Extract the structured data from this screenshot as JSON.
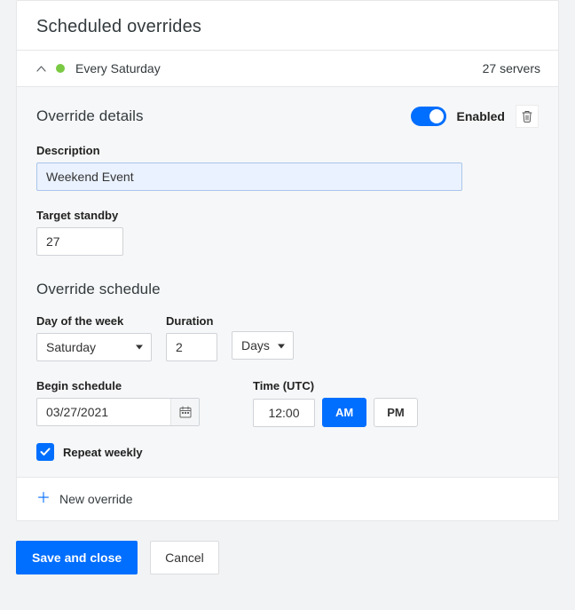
{
  "panel": {
    "title": "Scheduled overrides"
  },
  "summary": {
    "label": "Every Saturday",
    "count_text": "27 servers"
  },
  "details": {
    "heading": "Override details",
    "enabled_label": "Enabled",
    "enabled": true,
    "description_label": "Description",
    "description_value": "Weekend Event",
    "standby_label": "Target standby",
    "standby_value": "27"
  },
  "schedule": {
    "heading": "Override schedule",
    "day_label": "Day of the week",
    "day_value": "Saturday",
    "duration_label": "Duration",
    "duration_value": "2",
    "duration_unit": "Days",
    "begin_label": "Begin schedule",
    "begin_value": "03/27/2021",
    "time_label": "Time (UTC)",
    "time_value": "12:00",
    "am_label": "AM",
    "pm_label": "PM",
    "ampm_selected": "AM",
    "repeat_label": "Repeat weekly",
    "repeat_checked": true
  },
  "actions": {
    "new_override": "New override",
    "save": "Save and close",
    "cancel": "Cancel"
  }
}
